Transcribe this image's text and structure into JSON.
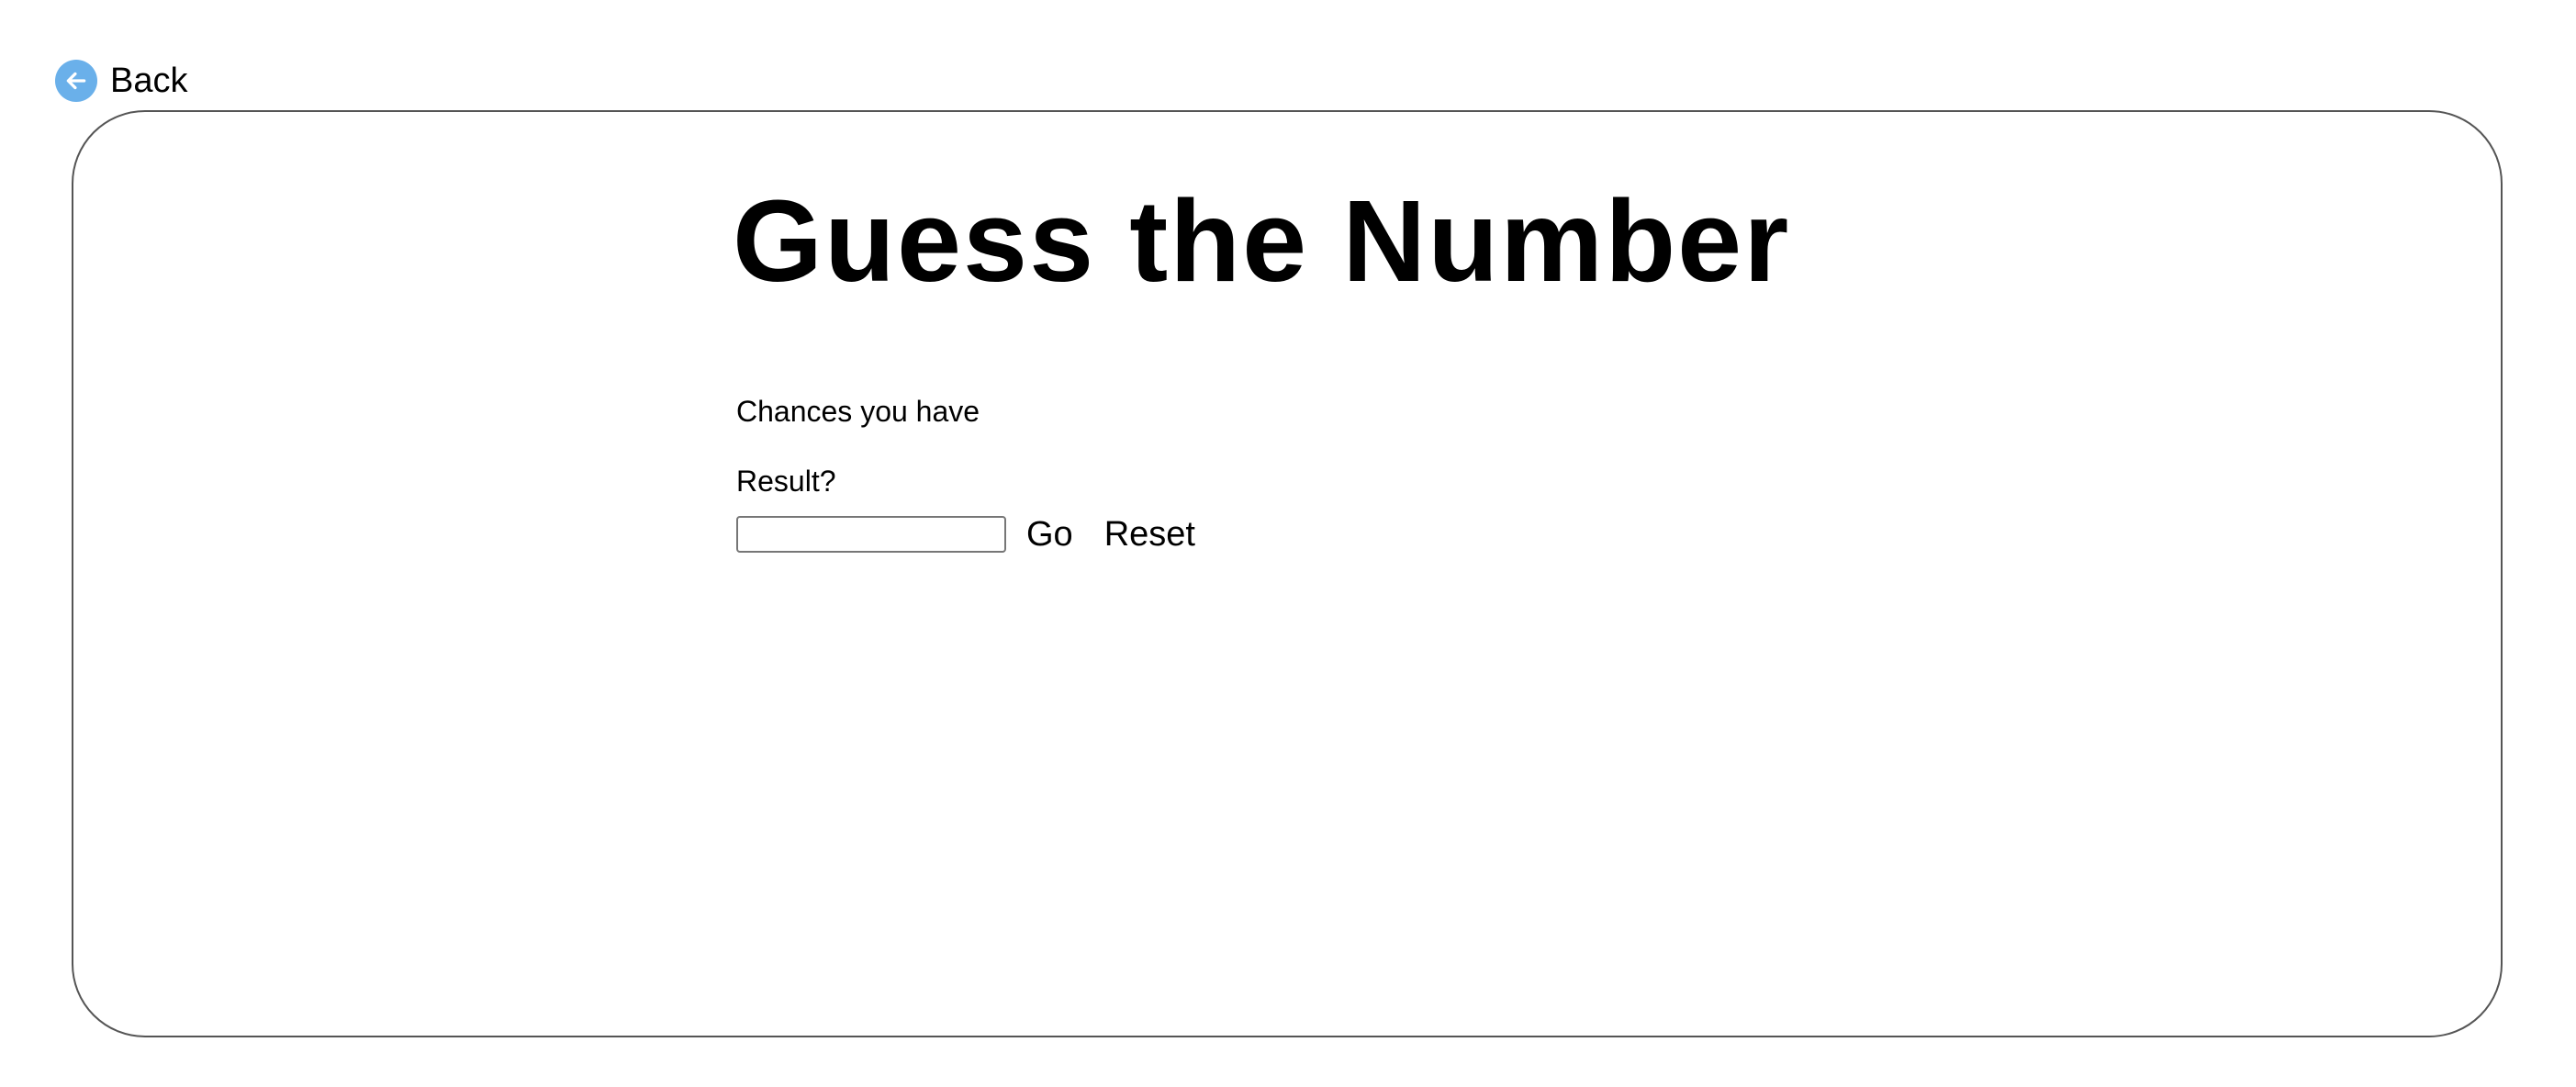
{
  "nav": {
    "back_label": "Back",
    "back_icon": "arrow-left-icon",
    "back_icon_color": "#6ab0ea"
  },
  "game": {
    "title": "Guess the Number",
    "chances_text": "Chances you have",
    "result_text": "Result?",
    "guess_input_value": "",
    "go_label": "Go",
    "reset_label": "Reset"
  }
}
